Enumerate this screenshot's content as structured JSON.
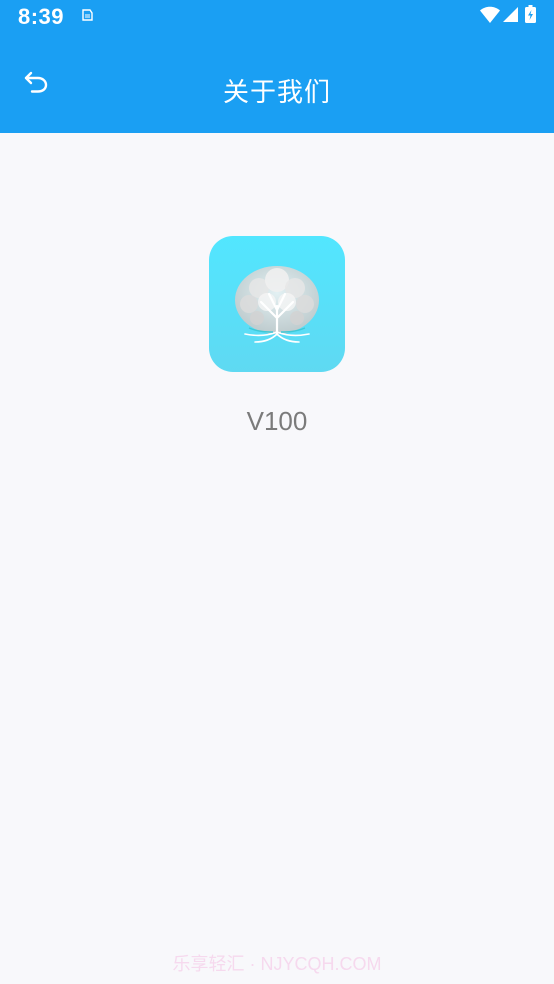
{
  "status_bar": {
    "time": "8:39",
    "icons": [
      "sim-card-icon",
      "wifi-icon",
      "signal-icon",
      "battery-charging-icon"
    ]
  },
  "header": {
    "back_icon": "back-arrow-icon",
    "title": "关于我们"
  },
  "app_info": {
    "icon": "tree-logo-icon",
    "version": "V100"
  },
  "watermark": {
    "text": "乐享轻汇 · NJYCQH.COM"
  },
  "colors": {
    "header_background": "#1a9ff3",
    "page_background": "#f8f8fb",
    "icon_gradient_top": "#52e6ff",
    "icon_gradient_bottom": "#5fd9f2",
    "version_text": "#7b7b7b",
    "watermark_text": "#f6d9ee"
  }
}
